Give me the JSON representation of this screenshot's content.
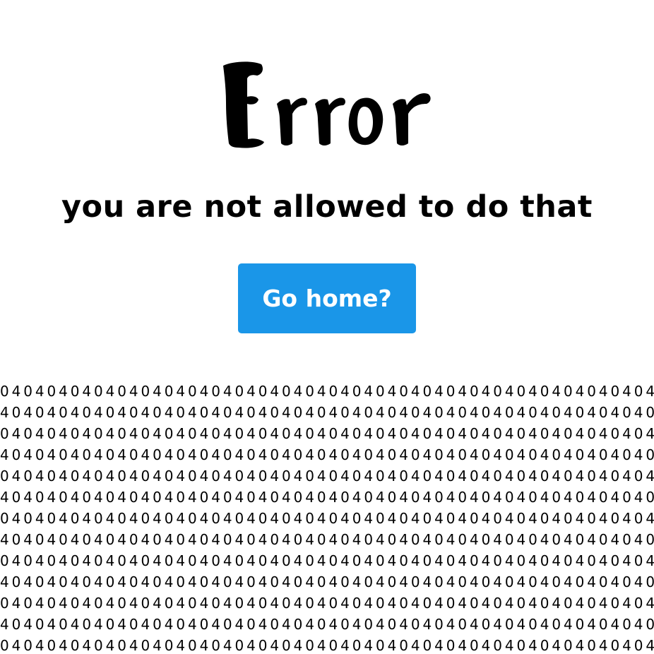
{
  "logo": {
    "text": "Error"
  },
  "message": "you are not allowed to do that",
  "home_button": {
    "label": "Go home?"
  },
  "pattern": {
    "rows": [
      "04040404040404040404040404040404040404040404040404040404040404040404",
      "40404040404040404040404040404040404040404040404040404040404040404040",
      "04040404040404040404040404040404040404040404040404040404040404040404",
      "40404040404040404040404040404040404040404040404040404040404040404040",
      "04040404040404040404040404040404040404040404040404040404040404040404",
      "40404040404040404040404040404040404040404040404040404040404040404040",
      "04040404040404040404040404040404040404040404040404040404040404040404",
      "40404040404040404040404040404040404040404040404040404040404040404040",
      "04040404040404040404040404040404040404040404040404040404040404040404",
      "40404040404040404040404040404040404040404040404040404040404040404040",
      "04040404040404040404040404040404040404040404040404040404040404040404",
      "40404040404040404040404040404040404040404040404040404040404040404040",
      "04040404040404040404040404040404040404040404040404040404040404040404"
    ]
  },
  "colors": {
    "button_background": "#1a96e8",
    "button_text": "#ffffff",
    "text": "#000000",
    "background": "#ffffff"
  }
}
